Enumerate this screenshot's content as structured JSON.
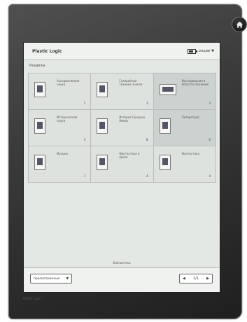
{
  "app": {
    "title": "Plastic Logic"
  },
  "header": {
    "options_label": "опции"
  },
  "section": {
    "title": "Разделы"
  },
  "tiles": [
    {
      "label": "Ассоциативная наука",
      "count": "1"
    },
    {
      "label": "Галерейная техника знаков",
      "count": "3"
    },
    {
      "label": "Исследования в области познания",
      "count": "3"
    },
    {
      "label": "Историческая наука",
      "count": "4"
    },
    {
      "label": "История Средних Веков",
      "count": "8"
    },
    {
      "label": "Литература",
      "count": "6"
    },
    {
      "label": "Музыка",
      "count": "7"
    },
    {
      "label": "Фантастика и проза",
      "count": "4"
    },
    {
      "label": "Фантастика",
      "count": "4"
    }
  ],
  "footer": {
    "caption": "Библиотека",
    "sort_label": "просмотренные",
    "page_indicator": "1/1",
    "brand": "Plastic Logic™"
  },
  "icons": {
    "home": "home-icon",
    "battery": "battery-icon",
    "dropdown": "chevron-down-icon",
    "prev": "chevron-left-icon",
    "next": "chevron-right-icon"
  }
}
